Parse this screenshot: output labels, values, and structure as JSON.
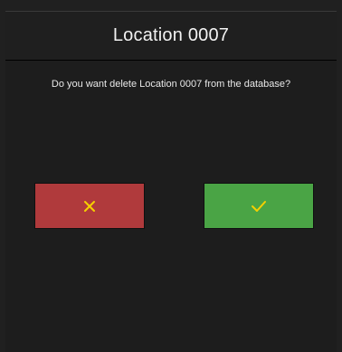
{
  "dialog": {
    "title": "Location 0007",
    "message": "Do you want delete Location 0007 from the database?"
  },
  "buttons": {
    "cancel": {
      "icon": "close-icon",
      "color": "#b03a3c",
      "icon_color": "#f5d000"
    },
    "confirm": {
      "icon": "checkmark-icon",
      "color": "#4aa445",
      "icon_color": "#f5d000"
    }
  }
}
